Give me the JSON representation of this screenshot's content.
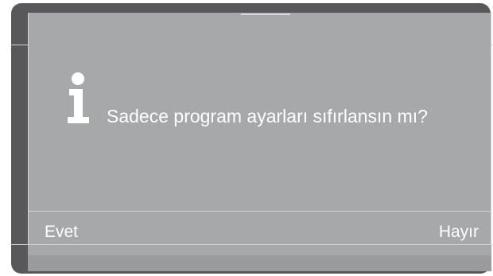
{
  "dialog": {
    "icon": "info-icon",
    "message": "Sadece program ayarları sıfırlansın mı?"
  },
  "softkeys": {
    "left_label": "Evet",
    "right_label": "Hayır"
  },
  "colors": {
    "bezel": "#58585a",
    "screen": "#a7a8aa",
    "text": "#ffffff",
    "divider": "#d0d1d3"
  }
}
